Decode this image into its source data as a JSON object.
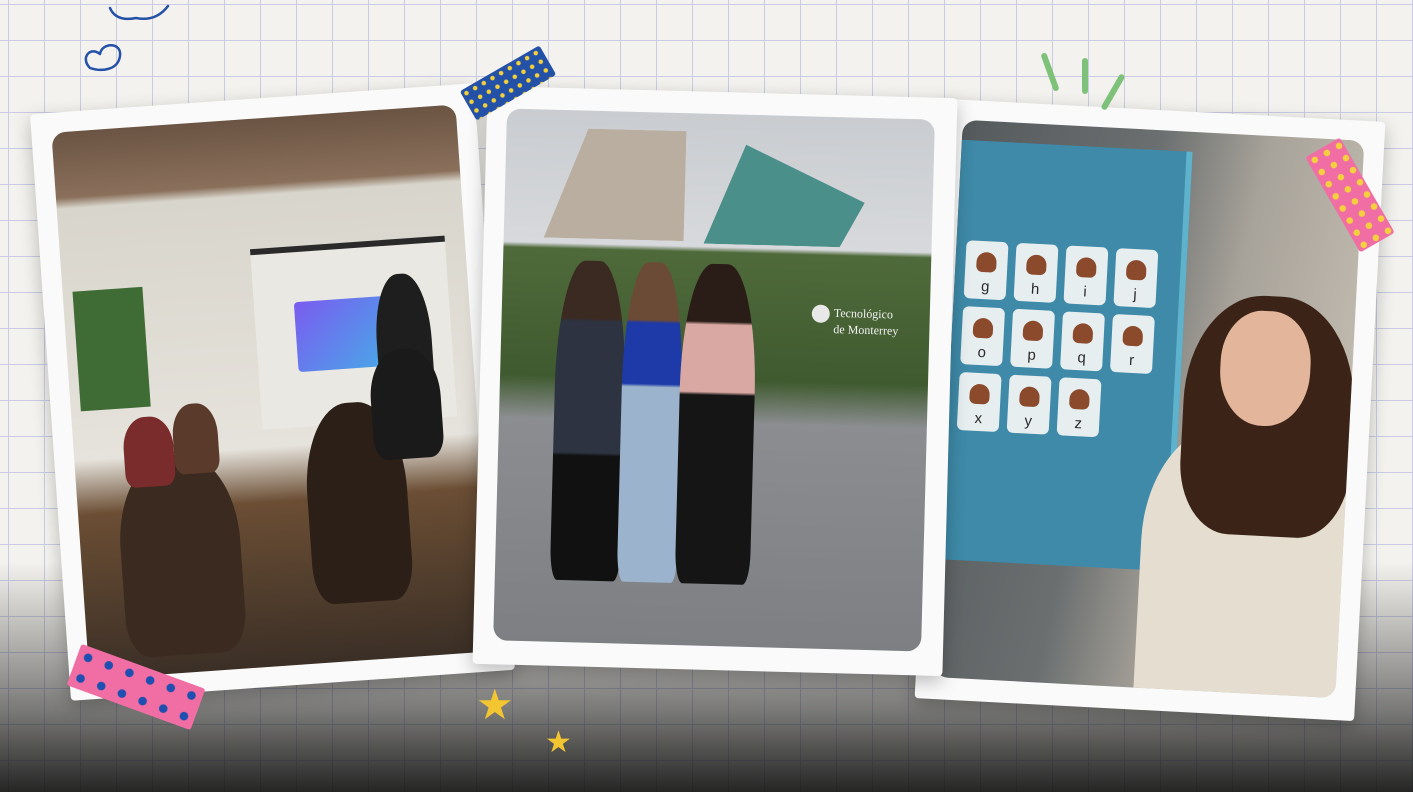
{
  "photos": [
    {
      "description": "",
      "scene": "workshop-presentation"
    },
    {
      "scene": "campus-group",
      "sign_text": [
        "Tecnológico",
        "de Monterrey"
      ]
    },
    {
      "scene": "sign-language-presentation",
      "keyboard_letters": [
        "g",
        "h",
        "i",
        "j",
        "o",
        "p",
        "q",
        "r",
        "x",
        "y",
        "z",
        ""
      ]
    }
  ],
  "colors": {
    "background": "#f3f2ee",
    "grid_line": "#c9cce4",
    "tape_blue": "#2451a8",
    "tape_pink": "#f06ea3",
    "star_yellow": "#f2c531",
    "doodle_blue": "#2451a8",
    "doodle_green": "#7ec27a"
  },
  "icons": [
    "cloud-doodle-icon",
    "heart-doodle-icon",
    "star-icon",
    "star-icon"
  ]
}
